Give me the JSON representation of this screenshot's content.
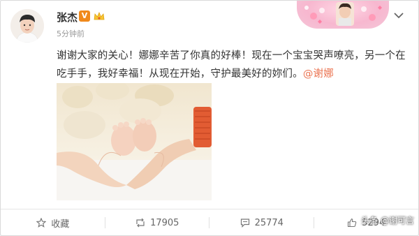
{
  "header": {
    "username": "张杰",
    "verified_badge": "V",
    "timestamp": "5分钟前",
    "menu_icon": "chevron-down-icon"
  },
  "post": {
    "text": "谢谢大家的关心！娜娜辛苦了你真的好棒！现在一个宝宝哭声嘹亮，另一个在吃手手，我好幸福！从现在开始，守护最美好的妳们。",
    "mention": "@谢娜"
  },
  "actions": {
    "favorite_label": "收藏",
    "repost_count": "17905",
    "comment_count": "25774",
    "like_count": "5294"
  },
  "watermark": "头条 @谢可言",
  "colors": {
    "accent": "#eb7350",
    "verified": "#f0891c"
  }
}
